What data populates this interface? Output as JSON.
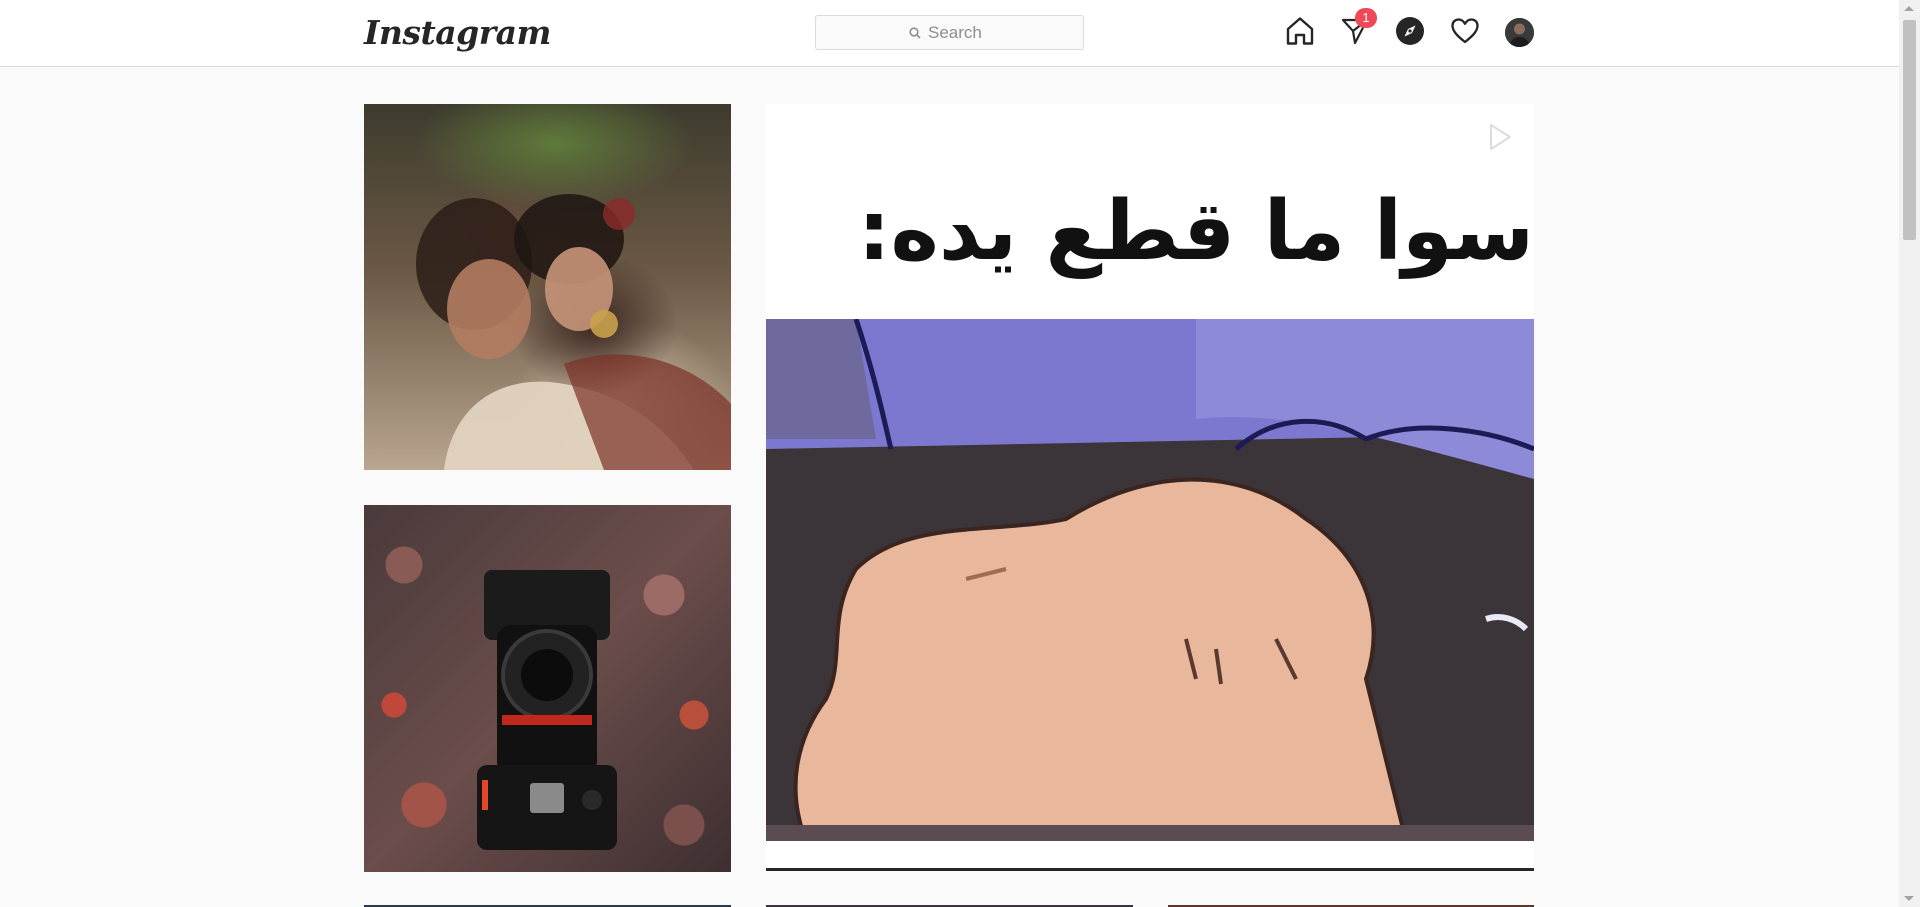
{
  "header": {
    "logo_text": "Instagram",
    "search": {
      "placeholder": "Search",
      "icon": "search-icon"
    },
    "nav": {
      "home_icon": "home-icon",
      "direct_icon": "direct-message-icon",
      "direct_badge": "1",
      "explore_icon": "explore-compass-icon",
      "activity_icon": "heart-icon",
      "profile_icon": "avatar"
    }
  },
  "feed": {
    "tiles": [
      {
        "kind": "photo",
        "subject": "couple-kiss-photo"
      },
      {
        "kind": "photo",
        "subject": "camera-on-pebbles-photo"
      },
      {
        "kind": "video",
        "subject": "cartoon-hand-video",
        "overlay_text": "سوا ما قطع يده:",
        "play_icon": "play-icon"
      }
    ]
  },
  "colors": {
    "badge": "#ed4956",
    "background": "#fafafa",
    "border": "#dbdbdb",
    "text": "#262626"
  }
}
